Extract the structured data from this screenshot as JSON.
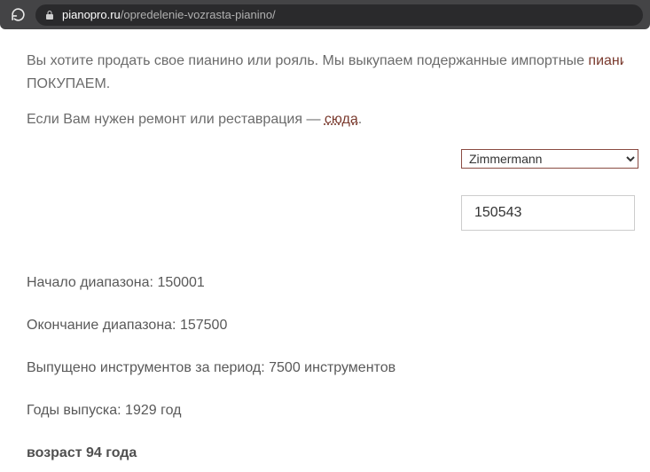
{
  "browser": {
    "url_host": "pianopro.ru",
    "url_path": "/opredelenie-vozrasta-pianino/"
  },
  "intro": {
    "line1_a": "Вы хотите продать свое пианино или рояль. Мы выкупаем подержанные импортные ",
    "line1_link": "пианино",
    "line2": "ПОКУПАЕМ.",
    "line3_a": "Если Вам нужен ремонт или реставрация  —  ",
    "line3_link": "сюда",
    "line3_b": "."
  },
  "form": {
    "brand_selected": "Zimmermann",
    "serial_value": "150543"
  },
  "results": {
    "range_start_label": "Начало диапазона: ",
    "range_start_value": "150001",
    "range_end_label": "Окончание диапазона: ",
    "range_end_value": "157500",
    "produced_label": "Выпущено инструментов за период: ",
    "produced_value": "7500 инструментов",
    "years_label": "Годы выпуска: ",
    "years_value": "1929 год",
    "age_text": "возраст 94 года"
  }
}
